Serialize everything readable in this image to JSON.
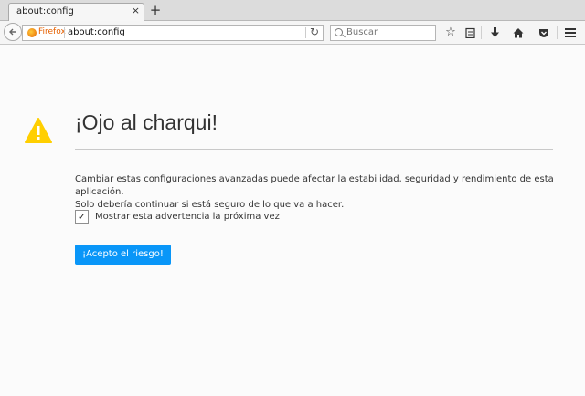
{
  "tabs": [
    {
      "title": "about:config",
      "close_glyph": "×"
    }
  ],
  "new_tab_glyph": "+",
  "navbar": {
    "identity_label": "Firefox",
    "url": "about:config",
    "search_placeholder": "Buscar"
  },
  "page": {
    "title": "¡Ojo al charqui!",
    "description_line1": "Cambiar estas configuraciones avanzadas puede afectar la estabilidad, seguridad y rendimiento de esta aplicación.",
    "description_line2": "Solo debería continuar si está seguro de lo que va a hacer.",
    "checkbox_label": "Mostrar esta advertencia la próxima vez",
    "checkbox_checked": true,
    "accept_button": "¡Acepto el riesgo!"
  },
  "colors": {
    "accent": "#0996f8",
    "warning": "#ffcf00"
  }
}
